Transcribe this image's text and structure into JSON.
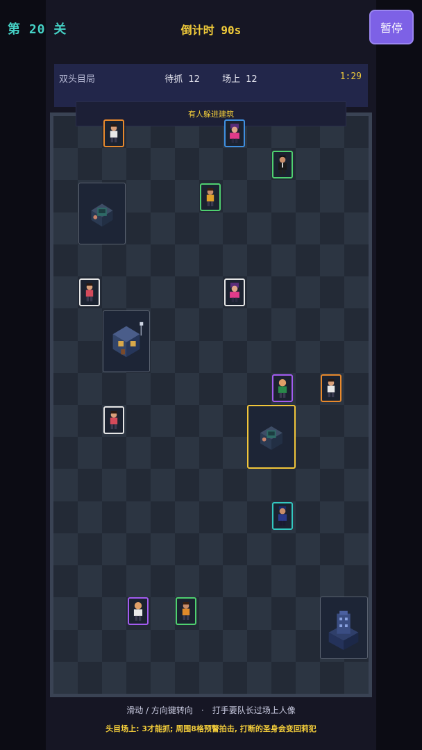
{
  "header": {
    "level": "第 20 关",
    "countdown": "倒计时 90s",
    "pause_label": "暂停"
  },
  "info": {
    "mode": "双头目局",
    "pending_label": "待抓",
    "pending_count": "12",
    "onfield_label": "场上",
    "onfield_count": "12",
    "timer": "1:29"
  },
  "notice": "有人躲进建筑",
  "footer": {
    "hint": "滑动 / 方向键转向　·　打手要队长过场上人像",
    "boss_tip": "头目场上: 3才能抓; 周围8格预警拍击, 打断的圣身会变回莉犯"
  },
  "colors": {
    "orange": "#e8892c",
    "blue": "#3f8fe0",
    "green": "#4fd070",
    "white": "#e6e6e6",
    "purple": "#a35cf0",
    "teal": "#33c8c0",
    "gold": "#f2c63a"
  },
  "units": [
    {
      "id": "u1",
      "color": "orange",
      "icon": "thug-white-icon"
    },
    {
      "id": "u2",
      "color": "blue",
      "icon": "boss-pink-icon"
    },
    {
      "id": "u3",
      "color": "green",
      "icon": "suit-man-icon"
    },
    {
      "id": "u4",
      "color": "green",
      "icon": "thug-yellow-icon"
    },
    {
      "id": "u5",
      "color": "white",
      "icon": "thug-red-icon"
    },
    {
      "id": "u6",
      "color": "white",
      "icon": "boss-pink-icon"
    },
    {
      "id": "u7",
      "color": "purple",
      "icon": "bald-green-icon"
    },
    {
      "id": "u8",
      "color": "orange",
      "icon": "thug-white-icon"
    },
    {
      "id": "u9",
      "color": "white",
      "icon": "thug-red-icon"
    },
    {
      "id": "u10",
      "color": "teal",
      "icon": "cop-blue-icon"
    },
    {
      "id": "u11",
      "color": "purple",
      "icon": "bald-white-icon"
    },
    {
      "id": "u12",
      "color": "green",
      "icon": "thug-orange-icon"
    }
  ],
  "buildings": [
    {
      "id": "b1",
      "icon": "kiosk-building-icon"
    },
    {
      "id": "b2",
      "icon": "shop-building-icon"
    },
    {
      "id": "b3",
      "icon": "kiosk-building-icon",
      "selected": true
    },
    {
      "id": "b4",
      "icon": "tower-building-icon"
    }
  ]
}
